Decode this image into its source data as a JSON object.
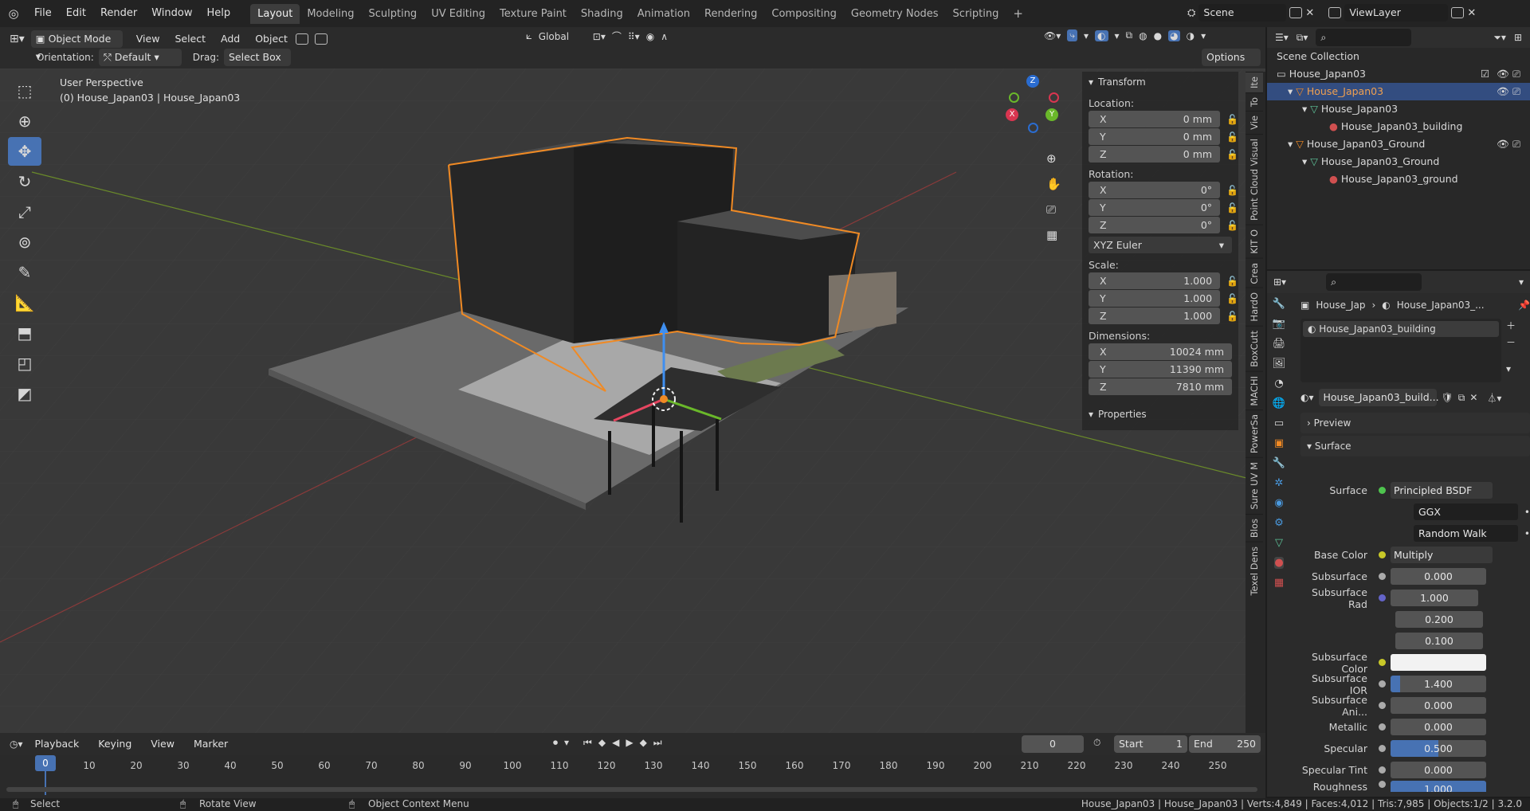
{
  "topbar": {
    "menus": [
      "File",
      "Edit",
      "Render",
      "Window",
      "Help"
    ],
    "workspaces": [
      "Layout",
      "Modeling",
      "Sculpting",
      "UV Editing",
      "Texture Paint",
      "Shading",
      "Animation",
      "Rendering",
      "Compositing",
      "Geometry Nodes",
      "Scripting"
    ],
    "active_workspace": "Layout",
    "plus": "+",
    "scene": "Scene",
    "view_layer": "ViewLayer"
  },
  "viewport_header": {
    "mode": "Object Mode",
    "menus": [
      "View",
      "Select",
      "Add",
      "Object"
    ],
    "transform_orientation": "Global",
    "orientation_label": "Orientation:",
    "orientation_value": "Default",
    "drag_label": "Drag:",
    "drag_value": "Select Box",
    "options": "Options"
  },
  "viewport": {
    "perspective": "User Perspective",
    "object_info": "(0) House_Japan03 | House_Japan03",
    "gizmo": {
      "x": "X",
      "y": "Y",
      "z": "Z"
    }
  },
  "npanel": {
    "transform_title": "Transform",
    "location_label": "Location:",
    "location": [
      {
        "axis": "X",
        "value": "0 mm"
      },
      {
        "axis": "Y",
        "value": "0 mm"
      },
      {
        "axis": "Z",
        "value": "0 mm"
      }
    ],
    "rotation_label": "Rotation:",
    "rotation": [
      {
        "axis": "X",
        "value": "0°"
      },
      {
        "axis": "Y",
        "value": "0°"
      },
      {
        "axis": "Z",
        "value": "0°"
      }
    ],
    "rotation_mode": "XYZ Euler",
    "scale_label": "Scale:",
    "scale": [
      {
        "axis": "X",
        "value": "1.000"
      },
      {
        "axis": "Y",
        "value": "1.000"
      },
      {
        "axis": "Z",
        "value": "1.000"
      }
    ],
    "dimensions_label": "Dimensions:",
    "dimensions": [
      {
        "axis": "X",
        "value": "10024 mm"
      },
      {
        "axis": "Y",
        "value": "11390 mm"
      },
      {
        "axis": "Z",
        "value": "7810 mm"
      }
    ],
    "properties_title": "Properties"
  },
  "side_tabs": [
    "Ite",
    "To",
    "Vie",
    "Point Cloud Visual",
    "KIT O",
    "Crea",
    "HardO",
    "BoxCutt",
    "MACHI",
    "PowerSa",
    "Sure UV M",
    "Blos",
    "Texel Dens"
  ],
  "outliner": {
    "root": "Scene Collection",
    "rows": [
      "House_Japan03",
      "House_Japan03",
      "House_Japan03",
      "House_Japan03_building",
      "House_Japan03_Ground",
      "House_Japan03_Ground",
      "House_Japan03_ground"
    ]
  },
  "properties": {
    "breadcrumb_object": "House_Jap",
    "breadcrumb_material": "House_Japan03_...",
    "slot": "House_Japan03_building",
    "material_name": "House_Japan03_build...",
    "preview": "Preview",
    "surface_section": "Surface",
    "surface_label": "Surface",
    "surface_value": "Principled BSDF",
    "distribution": "GGX",
    "subsurface_method": "Random Walk",
    "rows": [
      {
        "label": "Base Color",
        "value": "Multiply"
      },
      {
        "label": "Subsurface",
        "value": "0.000"
      },
      {
        "label": "Subsurface Rad",
        "value": "1.000"
      },
      {
        "label": "",
        "value": "0.200"
      },
      {
        "label": "",
        "value": "0.100"
      },
      {
        "label": "Subsurface Color",
        "value": ""
      },
      {
        "label": "Subsurface IOR",
        "value": "1.400"
      },
      {
        "label": "Subsurface Ani...",
        "value": "0.000"
      },
      {
        "label": "Metallic",
        "value": "0.000"
      },
      {
        "label": "Specular",
        "value": "0.500"
      },
      {
        "label": "Specular Tint",
        "value": "0.000"
      },
      {
        "label": "Roughness",
        "value": "1.000"
      }
    ]
  },
  "timeline": {
    "menus": [
      "Playback",
      "Keying",
      "View",
      "Marker"
    ],
    "current_frame": "0",
    "start_label": "Start",
    "start": "1",
    "end_label": "End",
    "end": "250",
    "ruler": [
      "0",
      "10",
      "20",
      "30",
      "40",
      "50",
      "60",
      "70",
      "80",
      "90",
      "100",
      "110",
      "120",
      "130",
      "140",
      "150",
      "160",
      "170",
      "180",
      "190",
      "200",
      "210",
      "220",
      "230",
      "240",
      "250"
    ]
  },
  "statusbar": {
    "left1": "Select",
    "left2": "Rotate View",
    "left3": "Object Context Menu",
    "right": "House_Japan03 | House_Japan03 | Verts:4,849 | Faces:4,012 | Tris:7,985 | Objects:1/2 | 3.2.0"
  }
}
